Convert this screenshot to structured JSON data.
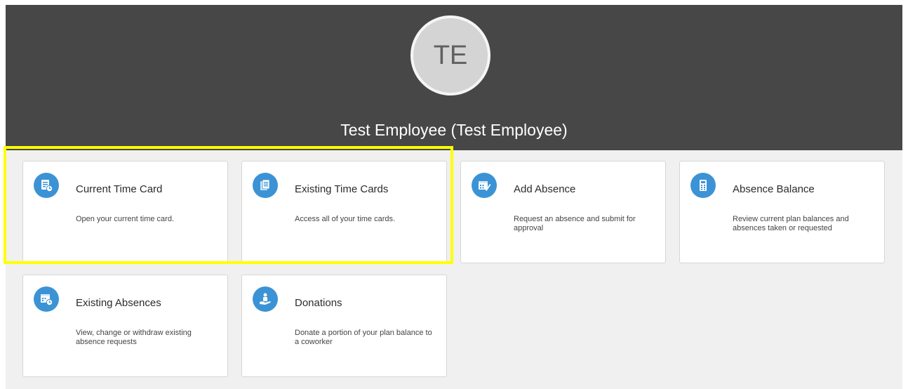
{
  "profile": {
    "initials": "TE",
    "name": "Test Employee (Test Employee)"
  },
  "cards": [
    {
      "title": "Current Time Card",
      "description": "Open your current time card.",
      "icon": "time-card-icon"
    },
    {
      "title": "Existing Time Cards",
      "description": "Access all of your time cards.",
      "icon": "time-cards-stack-icon"
    },
    {
      "title": "Add Absence",
      "description": "Request an absence and submit for approval",
      "icon": "calendar-edit-icon"
    },
    {
      "title": "Absence Balance",
      "description": "Review current plan balances and absences taken or requested",
      "icon": "calculator-icon"
    },
    {
      "title": "Existing Absences",
      "description": "View, change or withdraw existing absence requests",
      "icon": "calendar-clock-icon"
    },
    {
      "title": "Donations",
      "description": "Donate a portion of your plan balance to a coworker",
      "icon": "donation-hand-icon"
    }
  ],
  "colors": {
    "banner": "#474747",
    "icon_background": "#3b93d5",
    "highlight": "#ffff00"
  }
}
